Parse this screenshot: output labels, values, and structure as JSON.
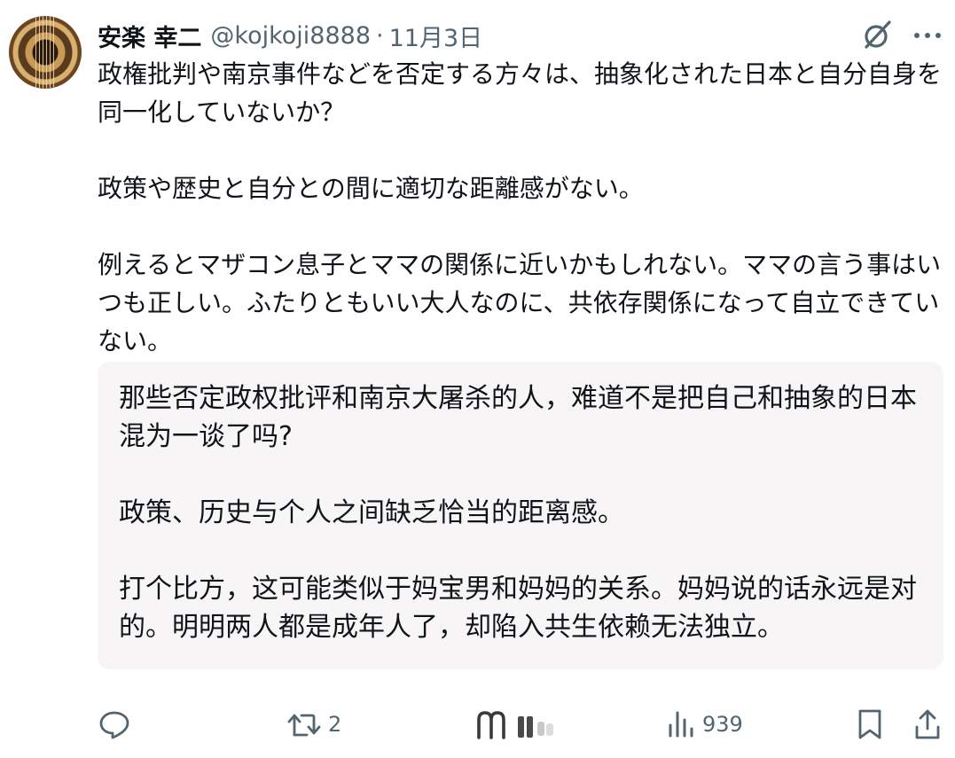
{
  "author": {
    "name": "安楽 幸二",
    "handle": "@kojkoji8888",
    "separator": "·",
    "date": "11月3日"
  },
  "body": {
    "paragraphs": [
      "政権批判や南京事件などを否定する方々は、抽象化された日本と自分自身を同一化していないか？",
      "政策や歴史と自分との間に適切な距離感がない。",
      "例えるとマザコン息子とママの関係に近いかもしれない。ママの言う事はいつも正しい。ふたりともいい大人なのに、共依存関係になって自立できていない。"
    ]
  },
  "translation": {
    "paragraphs": [
      "那些否定政权批评和南京大屠杀的人，难道不是把自己和抽象的日本混为一谈了吗?",
      "政策、历史与个人之间缺乏恰当的距离感。",
      "打个比方，这可能类似于妈宝男和妈妈的关系。妈妈说的话永远是对的。明明两人都是成年人了，却陷入共生依赖无法独立。"
    ]
  },
  "actions": {
    "reply": {
      "icon": "reply-icon",
      "count": ""
    },
    "retweet": {
      "icon": "retweet-icon",
      "count": "2"
    },
    "views": {
      "icon": "views-icon",
      "count": "939"
    },
    "bookmark": {
      "icon": "bookmark-icon"
    },
    "share": {
      "icon": "share-icon"
    }
  },
  "icons": {
    "header_right": [
      "grok-icon",
      "more-icon"
    ],
    "watermark": "weibo-watermark-icon"
  },
  "colors": {
    "text_primary": "#0f1419",
    "text_secondary": "#536471",
    "translation_bg": "#f7f5f5"
  }
}
